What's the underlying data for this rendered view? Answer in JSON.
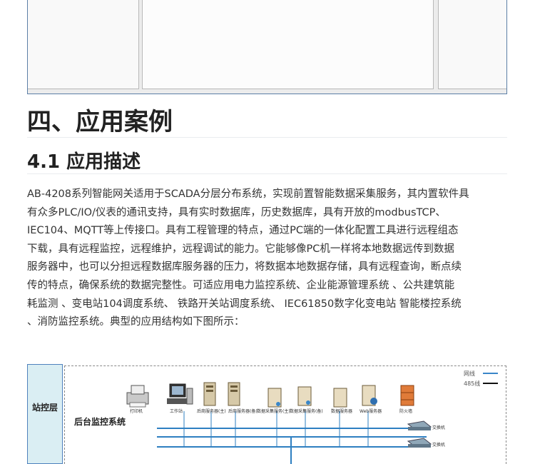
{
  "section": {
    "h1": "四、应用案例",
    "h2": "4.1 应用描述",
    "paragraph_lines": [
      "AB-4208系列智能网关适用于SCADA分层分布系统，实现前置智能数据采集服务，其内置软件具",
      "有众多PLC/IO/仪表的通讯支持，具有实时数据库，历史数据库，具有开放的modbusTCP、",
      "IEC104、MQTT等上传接口。具有工程管理的特点，通过PC端的一体化配置工具进行远程组态",
      "下载，具有远程监控，远程维护，远程调试的能力。它能够像PC机一样将本地数据远传到数据",
      "服务器中，也可以分担远程数据库服务器的压力，将数据本地数据存储，具有远程查询，断点续",
      "传的特点，确保系统的数据完整性。可适应用电力监控系统、企业能源管理系统 、公共建筑能",
      "耗监测 、变电站104调度系统、 铁路开关站调度系统、 IEC61850数字化变电站 智能楼控系统",
      "、消防监控系统。典型的应用结构如下图所示："
    ]
  },
  "diagram": {
    "layer_label": "站控层",
    "system_title": "后台监控系统",
    "legend": [
      {
        "label": "网线",
        "color": "#3a86c8"
      },
      {
        "label": "485线",
        "color": "#111111"
      }
    ],
    "devices": [
      "打印机",
      "工作站",
      "后商服务器(主)",
      "后商服务器(备)",
      "数据采集服务(主)",
      "数据采集服务(备)",
      "数据服务器",
      "Web服务器",
      "防火墙"
    ],
    "switch_labels": [
      "交换机",
      "交换机"
    ],
    "colors": {
      "frame_border": "#5b7fa6",
      "layer_fill": "#daeef3",
      "bus": "#2e7fc1"
    }
  }
}
